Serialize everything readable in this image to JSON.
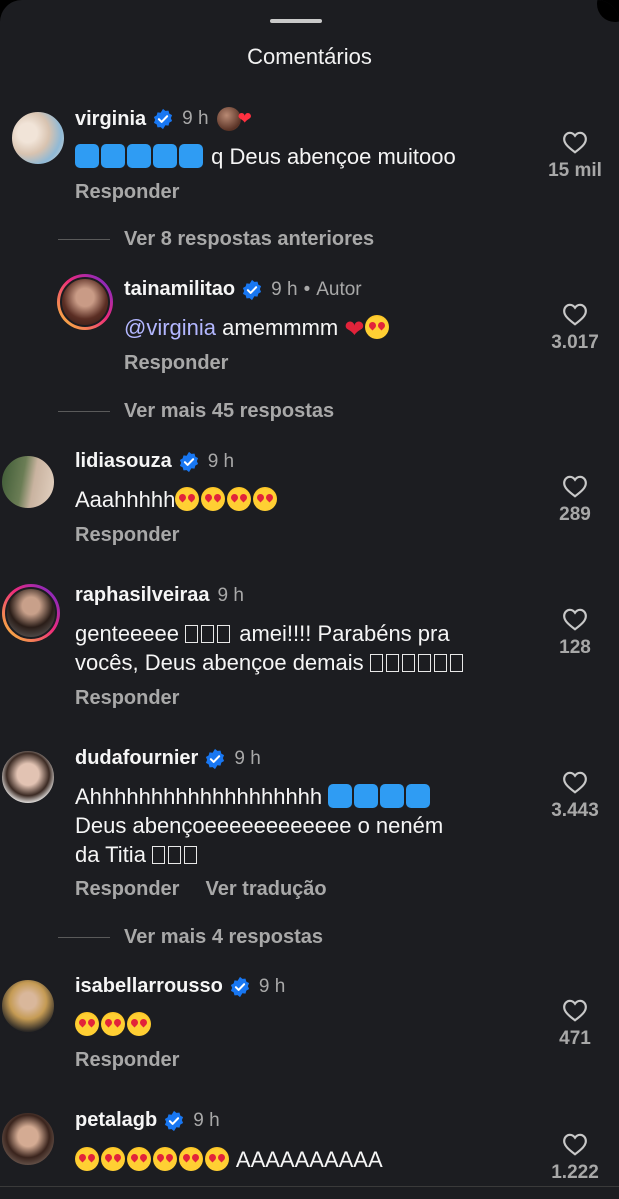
{
  "header": {
    "title": "Comentários"
  },
  "colors": {
    "background": "#1c1d21",
    "verified": "#1877f2",
    "mention": "#b3b7ff",
    "muted": "#a8a8a8",
    "heart_liked": "#ff3040"
  },
  "reply_label": "Responder",
  "translate_label": "Ver tradução",
  "comments": [
    {
      "username": "virginia",
      "time": "9 h",
      "text": "q Deus abençoe muitooo",
      "likes": "15 mil",
      "verified": true,
      "liked_by_author": true
    },
    {
      "username": "tainamilitao",
      "time": "9 h",
      "author_label": "Autor",
      "mention": "@virginia",
      "text": "amemmmm",
      "likes": "3.017",
      "verified": true
    },
    {
      "username": "lidiasouza",
      "time": "9 h",
      "text": "Aaahhhhh",
      "likes": "289",
      "verified": true
    },
    {
      "username": "raphasilveiraa",
      "time": "9 h",
      "text_line1": "amei!!!! Parabéns pra",
      "text_line1_prefix": "genteeeee",
      "text_line2": "vocês, Deus abençoe demais",
      "likes": "128",
      "verified": false
    },
    {
      "username": "dudafournier",
      "time": "9 h",
      "text_line1": "Ahhhhhhhhhhhhhhhhhhh",
      "text_line2": "Deus abençoeeeeeeeeeeee o neném",
      "text_line3": "da Titia",
      "likes": "3.443",
      "verified": true
    },
    {
      "username": "isabellarrousso",
      "time": "9 h",
      "text": "",
      "likes": "471",
      "verified": true
    },
    {
      "username": "petalagb",
      "time": "9 h",
      "text": "AAAAAAAAAA",
      "likes": "1.222",
      "verified": true
    }
  ],
  "thread_links": {
    "previous_replies": "Ver 8 respostas anteriores",
    "more_replies_45": "Ver mais 45 respostas",
    "more_replies_4": "Ver mais 4 respostas"
  },
  "icons": [
    "verified-badge-icon",
    "heart-outline-icon",
    "drag-handle"
  ]
}
